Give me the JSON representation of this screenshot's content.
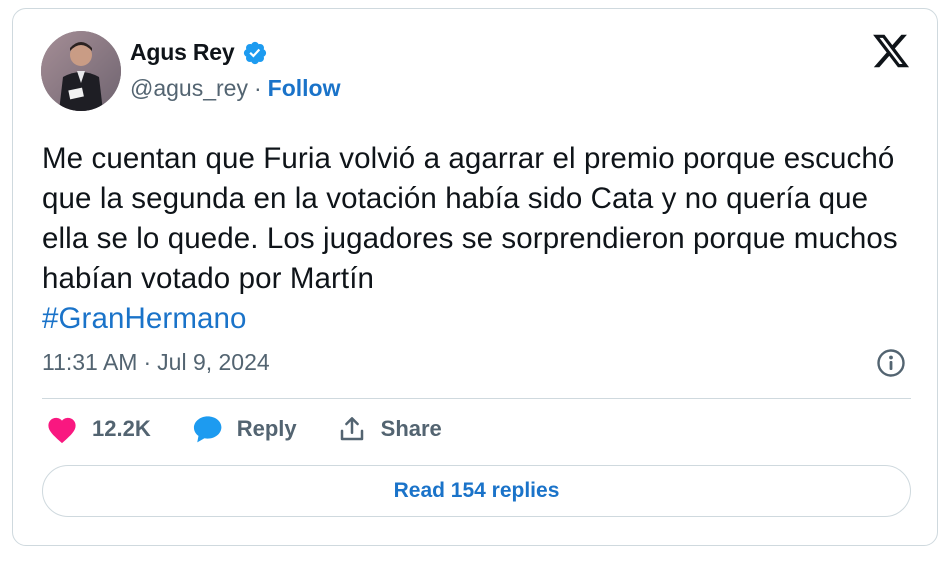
{
  "author": {
    "display_name": "Agus Rey",
    "handle": "@agus_rey",
    "separator": "·",
    "follow_label": "Follow",
    "verified": true
  },
  "tweet": {
    "text": "Me cuentan que Furia volvió a agarrar el premio porque escuchó que la segunda en la votación había sido Cata y no quería que ella se lo quede. Los jugadores se sorprendieron porque muchos habían votado por Martín",
    "hashtag": "#GranHermano"
  },
  "meta": {
    "time": "11:31 AM",
    "separator": "·",
    "date": "Jul 9, 2024"
  },
  "actions": {
    "like_count": "12.2K",
    "reply_label": "Reply",
    "share_label": "Share"
  },
  "replies_button": {
    "label": "Read 154 replies"
  },
  "colors": {
    "accent": "#1a73c9",
    "like": "#f91880",
    "reply_icon": "#1d9bf0",
    "muted": "#536471",
    "border": "#cfd9de"
  },
  "icons": [
    "verified-badge-icon",
    "x-logo-icon",
    "info-icon",
    "heart-icon",
    "reply-bubble-icon",
    "share-icon"
  ]
}
